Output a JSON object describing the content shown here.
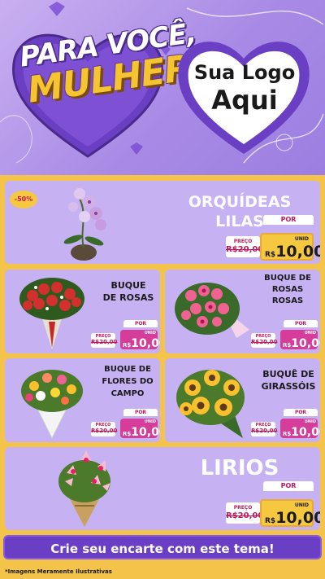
{
  "header": {
    "title_line1": "PARA VOCÊ,",
    "title_line2": "MULHER",
    "logo_line1": "Sua Logo",
    "logo_line2": "Aqui"
  },
  "products": [
    {
      "name": "ORQUÍDEAS LILAS",
      "badge": "-50%",
      "por_label": "POR",
      "preco_label": "PREÇO",
      "old_price": "R$20,00",
      "currency": "R$",
      "new_price": "10,00",
      "unit": "UNID"
    },
    {
      "name_line1": "BUQUE",
      "name_line2": "DE ROSAS",
      "por_label": "POR",
      "preco_label": "PREÇO",
      "old_price": "R$20,00",
      "currency": "R$",
      "new_price": "10,00",
      "unit": "UNID"
    },
    {
      "name_line1": "BUQUE DE",
      "name_line2": "ROSAS",
      "name_line3": "ROSAS",
      "por_label": "POR",
      "preco_label": "PREÇO",
      "old_price": "R$20,00",
      "currency": "R$",
      "new_price": "10,00",
      "unit": "UNID"
    },
    {
      "name_line1": "BUQUE DE",
      "name_line2": "FLORES DO",
      "name_line3": "CAMPO",
      "por_label": "POR",
      "preco_label": "PREÇO",
      "old_price": "R$20,00",
      "currency": "R$",
      "new_price": "10,00",
      "unit": "UNID"
    },
    {
      "name_line1": "BUQUÊ DE",
      "name_line2": "GIRASSÓIS",
      "por_label": "POR",
      "preco_label": "PREÇO",
      "old_price": "R$20,00",
      "currency": "R$",
      "new_price": "10,00",
      "unit": "UNID"
    },
    {
      "name": "LIRIOS",
      "por_label": "POR",
      "preco_label": "PREÇO",
      "old_price": "R$20,00",
      "currency": "R$",
      "new_price": "10,00",
      "unit": "UNID"
    }
  ],
  "footer": {
    "cta": "Crie seu encarte com este tema!",
    "disclaimer": "*Imagens Meramente Ilustrativas"
  },
  "colors": {
    "header_bg": "#a98be6",
    "panel_bg": "#c6b2f3",
    "page_bg": "#f3c34a",
    "accent_pink": "#d63c9a",
    "accent_yellow": "#f6c83f",
    "cta_bg": "#6a3fc6"
  }
}
